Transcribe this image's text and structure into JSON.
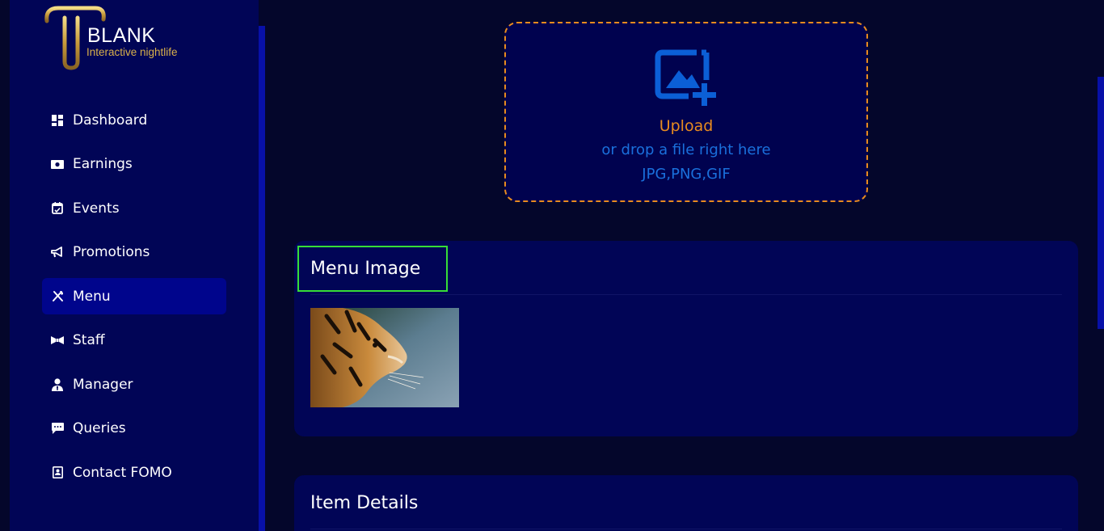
{
  "brand": {
    "name": "BLANK",
    "tagline": "Interactive nightlife",
    "accent_gold": "#d9b04a"
  },
  "sidebar": {
    "items": [
      {
        "label": "Dashboard",
        "icon": "dashboard-icon",
        "active": false
      },
      {
        "label": "Earnings",
        "icon": "money-icon",
        "active": false
      },
      {
        "label": "Events",
        "icon": "calendar-icon",
        "active": false
      },
      {
        "label": "Promotions",
        "icon": "megaphone-icon",
        "active": false
      },
      {
        "label": "Menu",
        "icon": "utensils-icon",
        "active": true
      },
      {
        "label": "Staff",
        "icon": "bowtie-icon",
        "active": false
      },
      {
        "label": "Manager",
        "icon": "user-tie-icon",
        "active": false
      },
      {
        "label": "Queries",
        "icon": "chat-icon",
        "active": false
      },
      {
        "label": "Contact FOMO",
        "icon": "contact-book-icon",
        "active": false
      }
    ]
  },
  "upload": {
    "icon": "add-image-icon",
    "title": "Upload",
    "subtitle": "or drop a file right here",
    "types": "JPG,PNG,GIF"
  },
  "menu_image_card": {
    "title": "Menu Image",
    "thumbnail": "tiger-photo"
  },
  "item_details_card": {
    "title": "Item Details"
  },
  "colors": {
    "background": "#04062b",
    "sidebar": "#010556",
    "active_nav": "#00058c",
    "upload_orange": "#e88b1f",
    "upload_blue": "#1a70dc",
    "highlight_green": "#37dd37"
  }
}
